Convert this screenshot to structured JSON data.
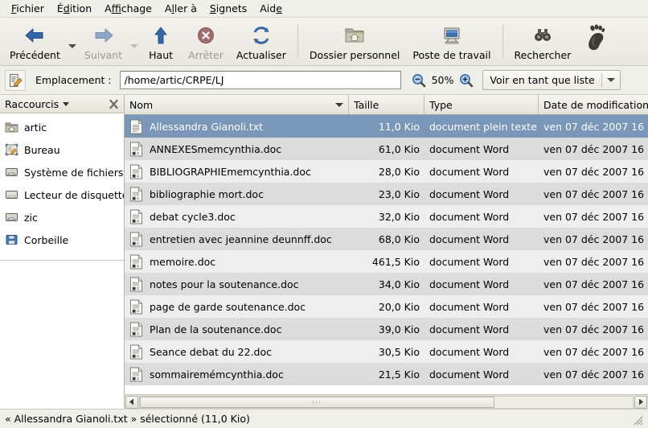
{
  "menubar": {
    "items": [
      {
        "pre": "F",
        "mid": "ichier",
        "label": "Fichier"
      },
      {
        "pre": "É",
        "mid": "dition",
        "label": "Édition"
      },
      {
        "pre": "A",
        "mid": "ffichage",
        "label": "Affichage"
      },
      {
        "pre": "A",
        "mid": "ller à",
        "label": "Aller à"
      },
      {
        "pre": "S",
        "mid": "ignets",
        "label": "Signets"
      },
      {
        "pre": "A",
        "mid": "ide",
        "label": "Aide"
      }
    ]
  },
  "toolbar": {
    "back": {
      "label": "Précédent",
      "icon": "arrow-left-icon",
      "disabled": false
    },
    "forward": {
      "label": "Suivant",
      "icon": "arrow-right-icon",
      "disabled": true
    },
    "up": {
      "label": "Haut",
      "icon": "arrow-up-icon",
      "disabled": false
    },
    "stop": {
      "label": "Arrêter",
      "icon": "stop-icon",
      "disabled": true
    },
    "reload": {
      "label": "Actualiser",
      "icon": "reload-icon",
      "disabled": false
    },
    "home": {
      "label": "Dossier personnel",
      "icon": "home-folder-icon",
      "disabled": false
    },
    "computer": {
      "label": "Poste de travail",
      "icon": "computer-icon",
      "disabled": false
    },
    "search": {
      "label": "Rechercher",
      "icon": "binoculars-icon",
      "disabled": false
    },
    "logo": {
      "icon": "gnome-foot-icon"
    }
  },
  "location": {
    "icon": "edit-location-icon",
    "label": "Emplacement :",
    "value": "/home/artic/CRPE/LJ",
    "placeholder": "",
    "zoom_out_icon": "zoom-out-icon",
    "zoom_level": "50%",
    "zoom_in_icon": "zoom-in-icon",
    "view_mode": "Voir en tant que liste"
  },
  "sidebar": {
    "title": "Raccourcis",
    "caret_icon": "chevron-down-icon",
    "close_icon": "close-icon",
    "items": [
      {
        "label": "artic",
        "icon": "home-folder-icon"
      },
      {
        "label": "Bureau",
        "icon": "desktop-icon"
      },
      {
        "label": "Système de fichiers",
        "icon": "drive-icon"
      },
      {
        "label": "Lecteur de disquette",
        "icon": "floppy-drive-icon"
      },
      {
        "label": "zic",
        "icon": "drive-icon"
      },
      {
        "label": "Corbeille",
        "icon": "trash-icon"
      }
    ]
  },
  "filelist": {
    "columns": [
      {
        "key": "name",
        "label": "Nom",
        "sorted": true,
        "sort_icon": "sort-desc-icon"
      },
      {
        "key": "size",
        "label": "Taille",
        "sorted": false
      },
      {
        "key": "type",
        "label": "Type",
        "sorted": false
      },
      {
        "key": "date",
        "label": "Date de modification",
        "sorted": false
      }
    ],
    "rows": [
      {
        "icon": "text-file-icon",
        "name": "Allessandra Gianoli.txt",
        "size": "11,0 Kio",
        "type": "document plein texte",
        "date": "ven 07 déc 2007 16",
        "selected": true
      },
      {
        "icon": "word-file-icon",
        "name": "ANNEXESmemcynthia.doc",
        "size": "61,0 Kio",
        "type": "document Word",
        "date": "ven 07 déc 2007 16",
        "selected": false
      },
      {
        "icon": "word-file-icon",
        "name": "BIBLIOGRAPHIEmemcynthia.doc",
        "size": "28,0 Kio",
        "type": "document Word",
        "date": "ven 07 déc 2007 16",
        "selected": false
      },
      {
        "icon": "word-file-icon",
        "name": "bibliographie mort.doc",
        "size": "23,0 Kio",
        "type": "document Word",
        "date": "ven 07 déc 2007 16",
        "selected": false
      },
      {
        "icon": "word-file-icon",
        "name": "debat cycle3.doc",
        "size": "32,0 Kio",
        "type": "document Word",
        "date": "ven 07 déc 2007 16",
        "selected": false
      },
      {
        "icon": "word-file-icon",
        "name": "entretien avec jeannine deunnff.doc",
        "size": "68,0 Kio",
        "type": "document Word",
        "date": "ven 07 déc 2007 16",
        "selected": false
      },
      {
        "icon": "word-file-icon",
        "name": "memoire.doc",
        "size": "461,5 Kio",
        "type": "document Word",
        "date": "ven 07 déc 2007 16",
        "selected": false
      },
      {
        "icon": "word-file-icon",
        "name": "notes pour la soutenance.doc",
        "size": "34,0 Kio",
        "type": "document Word",
        "date": "ven 07 déc 2007 16",
        "selected": false
      },
      {
        "icon": "word-file-icon",
        "name": "page de garde soutenance.doc",
        "size": "20,0 Kio",
        "type": "document Word",
        "date": "ven 07 déc 2007 16",
        "selected": false
      },
      {
        "icon": "word-file-icon",
        "name": "Plan de la soutenance.doc",
        "size": "39,0 Kio",
        "type": "document Word",
        "date": "ven 07 déc 2007 16",
        "selected": false
      },
      {
        "icon": "word-file-icon",
        "name": "Seance debat du 22.doc",
        "size": "30,5 Kio",
        "type": "document Word",
        "date": "ven 07 déc 2007 16",
        "selected": false
      },
      {
        "icon": "word-file-icon",
        "name": "sommairemémcynthia.doc",
        "size": "21,5 Kio",
        "type": "document Word",
        "date": "ven 07 déc 2007 16",
        "selected": false
      }
    ]
  },
  "statusbar": {
    "text": "« Allessandra Gianoli.txt » sélectionné (11,0 Kio)",
    "resize_grip_icon": "resize-grip-icon"
  },
  "colors": {
    "selection": "#7a96b8",
    "row_odd": "#dcdcdc",
    "row_even": "#eeeeee",
    "chrome": "#efefe9",
    "accent_blue": "#3465a4"
  }
}
